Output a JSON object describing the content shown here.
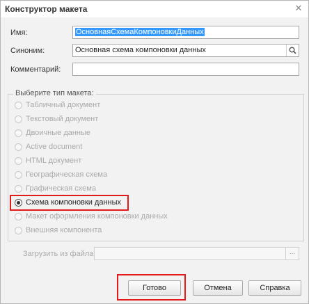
{
  "window": {
    "title": "Конструктор макета",
    "close_icon": "close-icon"
  },
  "fields": {
    "name_label": "Имя:",
    "name_value": "ОсновнаяСхемаКомпоновкиДанных",
    "synonym_label": "Синоним:",
    "synonym_value": "Основная схема компоновки данных",
    "comment_label": "Комментарий:",
    "comment_value": ""
  },
  "layout_type": {
    "group_title": "Выберите тип макета:",
    "options": [
      {
        "label": "Табличный документ",
        "selected": false,
        "enabled": false
      },
      {
        "label": "Текстовый документ",
        "selected": false,
        "enabled": false
      },
      {
        "label": "Двоичные данные",
        "selected": false,
        "enabled": false
      },
      {
        "label": "Active document",
        "selected": false,
        "enabled": false
      },
      {
        "label": "HTML документ",
        "selected": false,
        "enabled": false
      },
      {
        "label": "Географическая схема",
        "selected": false,
        "enabled": false
      },
      {
        "label": "Графическая схема",
        "selected": false,
        "enabled": false
      },
      {
        "label": "Схема компоновки данных",
        "selected": true,
        "enabled": true
      },
      {
        "label": "Макет оформления компоновки данных",
        "selected": false,
        "enabled": false
      },
      {
        "label": "Внешняя компонента",
        "selected": false,
        "enabled": false
      }
    ]
  },
  "load_file": {
    "label": "Загрузить из файла:",
    "value": "",
    "browse_label": "..."
  },
  "buttons": {
    "done": "Готово",
    "cancel": "Отмена",
    "help": "Справка"
  },
  "colors": {
    "highlight": "#e21a1a",
    "selection": "#3399ff"
  }
}
